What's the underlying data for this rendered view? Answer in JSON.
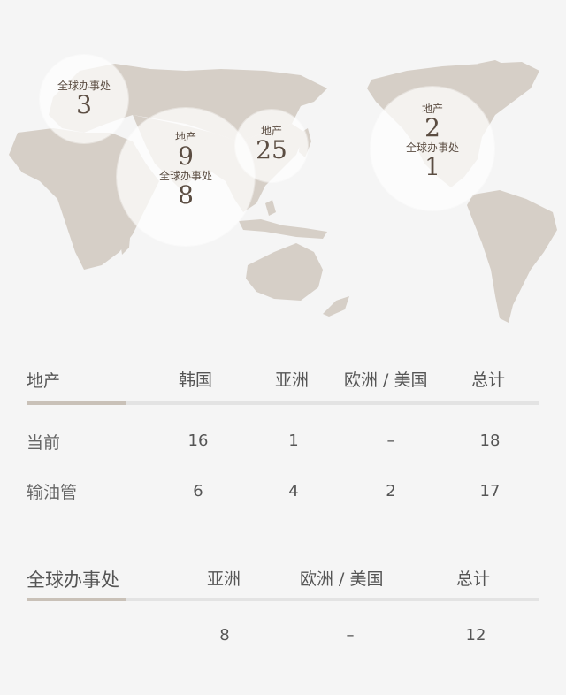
{
  "map": {
    "bubbles": [
      {
        "id": "europe",
        "lines": [
          {
            "label": "全球办事处",
            "num": "3"
          }
        ]
      },
      {
        "id": "asia",
        "lines": [
          {
            "label": "地产",
            "num": "9"
          },
          {
            "label": "全球办事处",
            "num": "8"
          }
        ]
      },
      {
        "id": "korea",
        "lines": [
          {
            "label": "地产",
            "num": "25"
          }
        ]
      },
      {
        "id": "america",
        "lines": [
          {
            "label": "地产",
            "num": "2"
          },
          {
            "label": "全球办事处",
            "num": "1"
          }
        ]
      }
    ]
  },
  "properties": {
    "title": "地产",
    "columns": [
      "韩国",
      "亚洲",
      "欧洲 / 美国",
      "总计"
    ],
    "rows": [
      {
        "label": "当前",
        "values": [
          "16",
          "1",
          "–",
          "18"
        ]
      },
      {
        "label": "输油管",
        "values": [
          "6",
          "4",
          "2",
          "17"
        ]
      }
    ]
  },
  "offices": {
    "title": "全球办事处",
    "columns": [
      "亚洲",
      "欧洲 / 美国",
      "总计"
    ],
    "rows": [
      {
        "values": [
          "8",
          "–",
          "12"
        ]
      }
    ]
  },
  "colors": {
    "continent": "#d6cfc7",
    "accent_rule": "#c9c1b8",
    "rule": "#e3e3e3"
  }
}
